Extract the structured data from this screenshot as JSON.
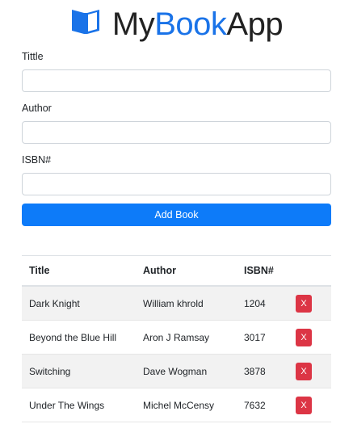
{
  "brand": {
    "my": "My",
    "book": "Book",
    "app": "App",
    "icon": "book-open-icon",
    "accent_color": "#1a73e8"
  },
  "form": {
    "title_label": "Tittle",
    "title_value": "",
    "author_label": "Author",
    "author_value": "",
    "isbn_label": "ISBN#",
    "isbn_value": "",
    "add_button_label": "Add Book",
    "button_color": "#0d7bf9"
  },
  "table": {
    "headers": [
      "Title",
      "Author",
      "ISBN#"
    ],
    "rows": [
      {
        "title": "Dark Knight",
        "author": "William khrold",
        "isbn": "1204",
        "delete_label": "X"
      },
      {
        "title": "Beyond the Blue Hill",
        "author": "Aron J Ramsay",
        "isbn": "3017",
        "delete_label": "X"
      },
      {
        "title": "Switching",
        "author": "Dave Wogman",
        "isbn": "3878",
        "delete_label": "X"
      },
      {
        "title": "Under The Wings",
        "author": "Michel McCensy",
        "isbn": "7632",
        "delete_label": "X"
      }
    ],
    "delete_color": "#dc3545"
  }
}
